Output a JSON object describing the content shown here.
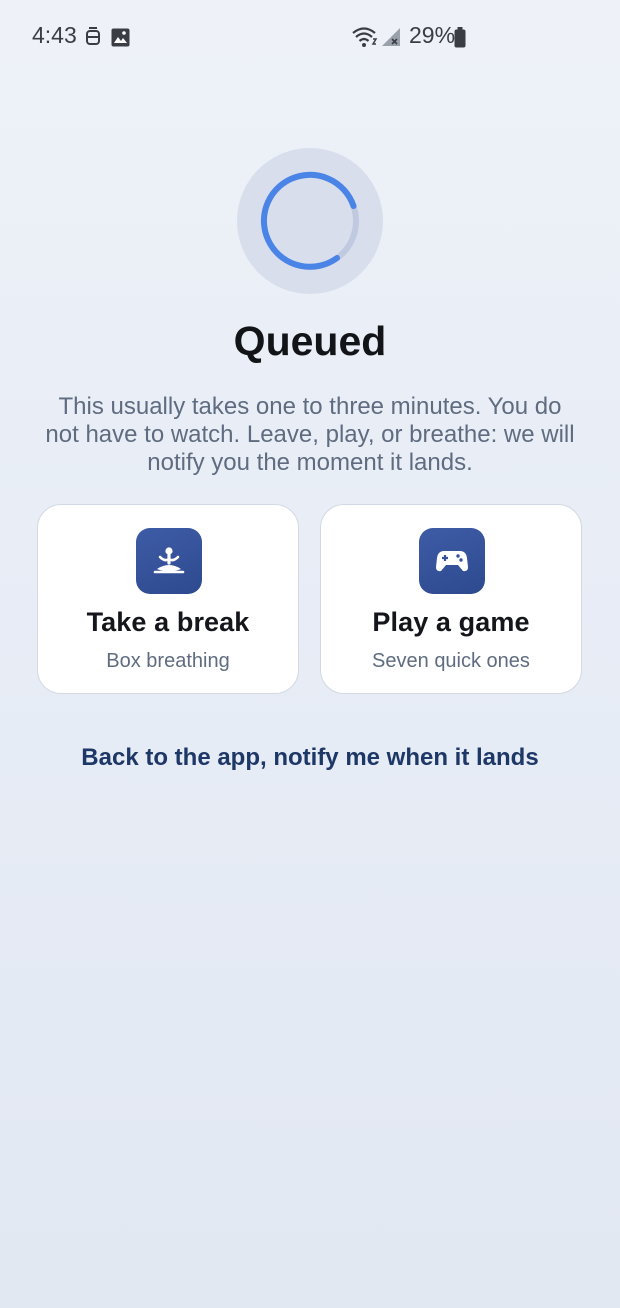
{
  "status_bar": {
    "time": "4:43",
    "battery_percent": "29%",
    "icons": [
      "notification-robot-icon",
      "gallery-icon",
      "wifi-icon",
      "cellular-signal-icon",
      "battery-icon"
    ]
  },
  "loader": {
    "icon": "loading-spinner-icon",
    "accent_color": "#4a84e6"
  },
  "title": "Queued",
  "description": "This usually takes one to three minutes. You do not have to watch. Leave, play, or breathe: we will notify you the moment it lands.",
  "options": [
    {
      "icon": "meditation-icon",
      "title": "Take a break",
      "subtitle": "Box breathing"
    },
    {
      "icon": "gamepad-icon",
      "title": "Play a game",
      "subtitle": "Seven quick ones"
    }
  ],
  "back_link": "Back to the app, notify me when it lands",
  "colors": {
    "card_icon_bg": "#34519a",
    "link": "#1d3766"
  }
}
